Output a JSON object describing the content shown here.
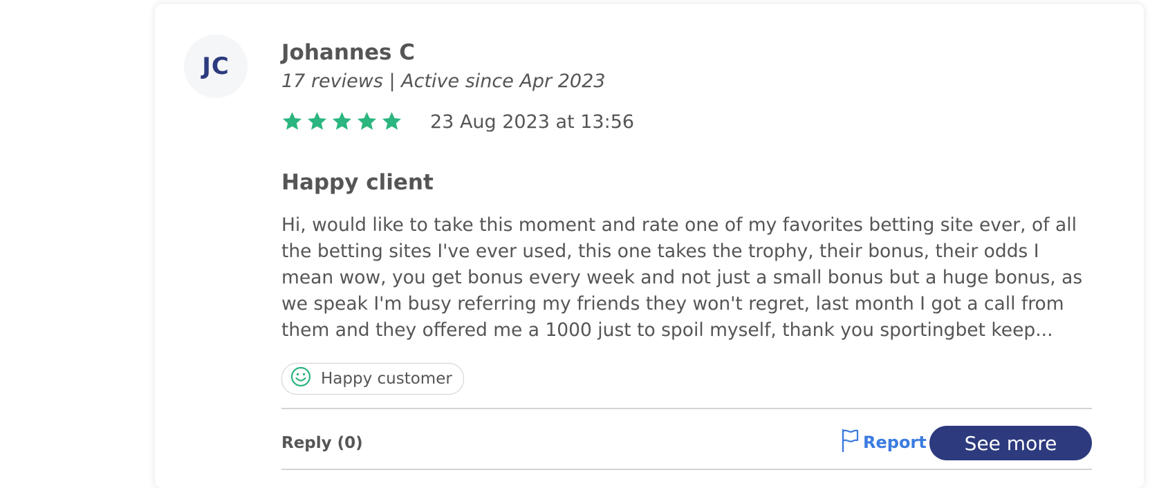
{
  "review": {
    "author": {
      "initials": "JC",
      "name": "Johannes C",
      "meta": "17 reviews | Active since Apr 2023"
    },
    "rating": 5,
    "rating_max": 5,
    "star_color": "#2bb57f",
    "date": "23 Aug 2023 at 13:56",
    "title": "Happy client",
    "body": "Hi, would like to take this moment and rate one of my favorites betting site ever, of all the betting sites I've ever used, this one takes the trophy, their bonus, their odds I mean wow, you get bonus every week and not just a small bonus but a huge bonus, as we speak I'm busy referring my friends they won't regret, last month I got a call from them and they offered me a 1000 just to spoil myself, thank you sportingbet keep...",
    "tag": {
      "icon": "smiley-icon",
      "label": "Happy customer"
    }
  },
  "actions": {
    "reply_label": "Reply (0)",
    "report_label": "Report",
    "see_more_label": "See more"
  },
  "colors": {
    "brand": "#2d3a7e",
    "link": "#3b7be0",
    "star": "#2bb57f"
  }
}
